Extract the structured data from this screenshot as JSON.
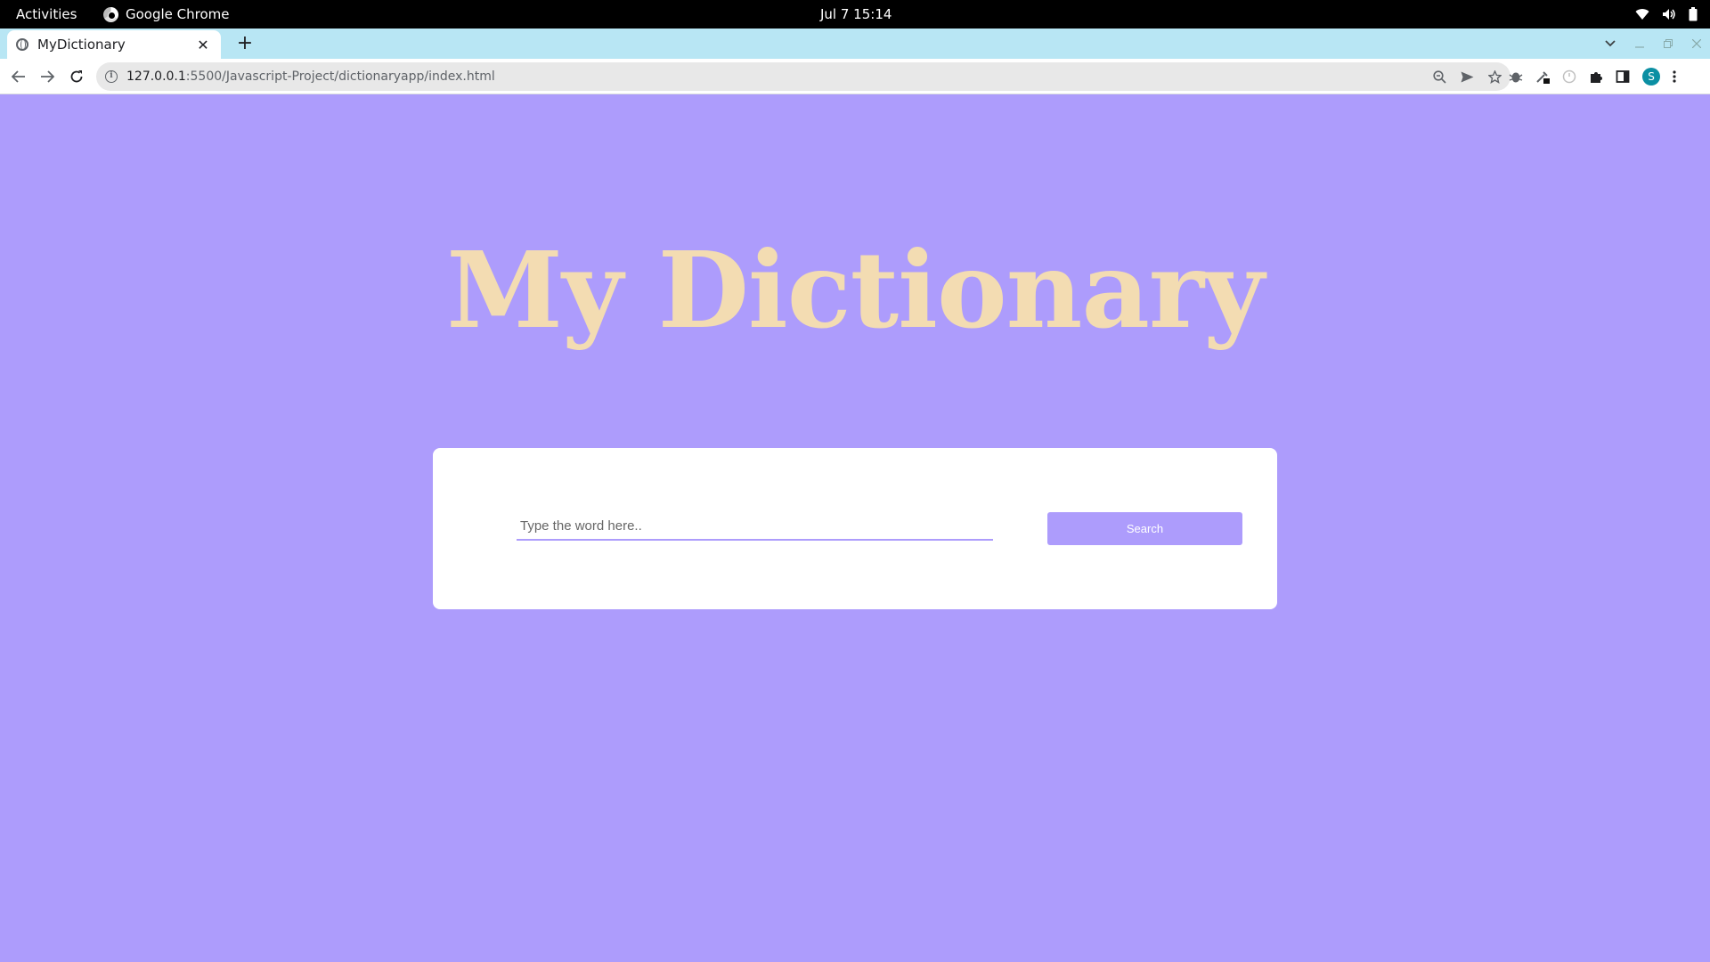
{
  "system_bar": {
    "activities": "Activities",
    "app_name": "Google Chrome",
    "clock": "Jul 7  15:14",
    "icons": [
      "wifi-icon",
      "volume-icon",
      "battery-icon"
    ]
  },
  "browser": {
    "tab": {
      "title": "MyDictionary",
      "close_glyph": "✕"
    },
    "new_tab_glyph": "+",
    "address": {
      "host": "127.0.0.1",
      "path": ":5500/Javascript-Project/dictionaryapp/index.html"
    },
    "profile_initial": "S",
    "colors": {
      "tabstrip": "#b8e6f4",
      "avatar": "#0b8fa3"
    }
  },
  "page": {
    "heading": "My Dictionary",
    "search": {
      "placeholder": "Type the word here..",
      "value": "",
      "button_label": "Search"
    },
    "colors": {
      "background": "#ad9cfc",
      "heading": "#f3dcb2",
      "card": "#ffffff",
      "button": "#ad9cfc"
    }
  }
}
